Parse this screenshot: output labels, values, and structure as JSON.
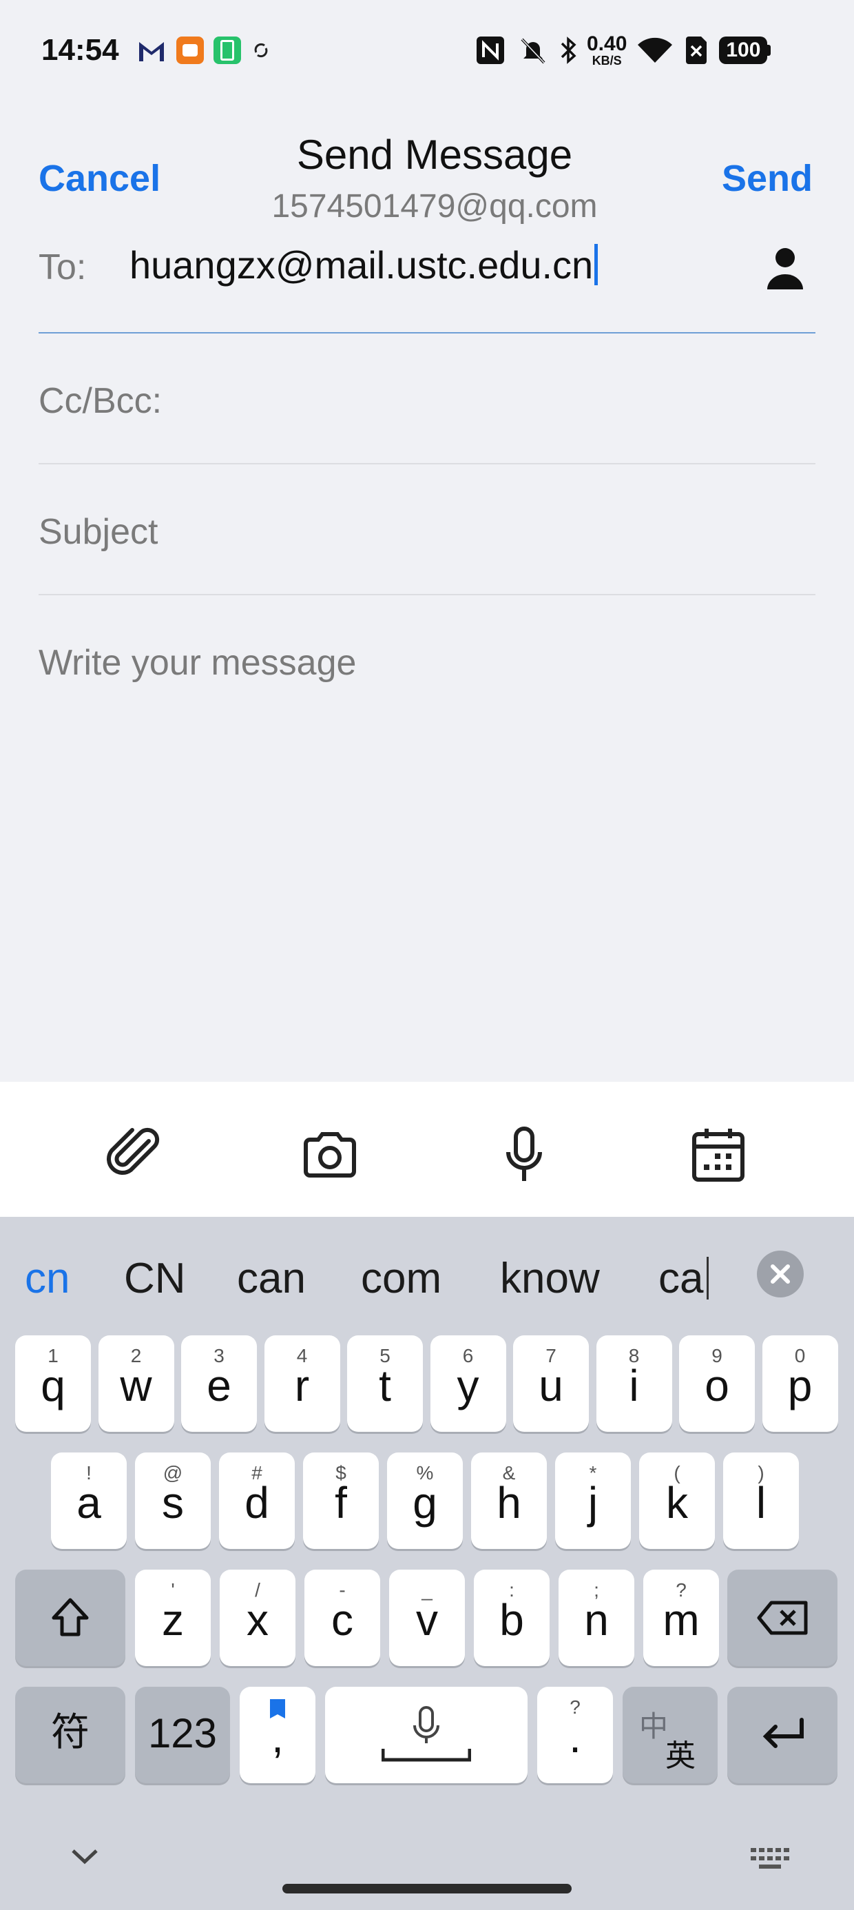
{
  "status": {
    "time": "14:54",
    "net_speed": "0.40",
    "net_unit": "KB/S",
    "battery": "100",
    "icons": [
      "gmail-icon",
      "app-icon",
      "battery-saver-icon",
      "sync-icon",
      "nfc-icon",
      "mute-icon",
      "bluetooth-icon",
      "wifi-icon",
      "sim-off-icon",
      "battery-icon"
    ]
  },
  "header": {
    "cancel": "Cancel",
    "title": "Send Message",
    "from": "1574501479@qq.com",
    "send": "Send"
  },
  "fields": {
    "to_label": "To:",
    "to_value": "huangzx@mail.ustc.edu.cn",
    "cc_label": "Cc/Bcc:",
    "subject_placeholder": "Subject",
    "message_placeholder": "Write your message"
  },
  "toolbar": [
    "attach-icon",
    "camera-icon",
    "microphone-icon",
    "calendar-icon"
  ],
  "suggestions": [
    "cn",
    "CN",
    "can",
    "com",
    "know",
    "ca"
  ],
  "keyboard": {
    "row1": [
      {
        "k": "q",
        "h": "1"
      },
      {
        "k": "w",
        "h": "2"
      },
      {
        "k": "e",
        "h": "3"
      },
      {
        "k": "r",
        "h": "4"
      },
      {
        "k": "t",
        "h": "5"
      },
      {
        "k": "y",
        "h": "6"
      },
      {
        "k": "u",
        "h": "7"
      },
      {
        "k": "i",
        "h": "8"
      },
      {
        "k": "o",
        "h": "9"
      },
      {
        "k": "p",
        "h": "0"
      }
    ],
    "row2": [
      {
        "k": "a",
        "h": "!"
      },
      {
        "k": "s",
        "h": "@"
      },
      {
        "k": "d",
        "h": "#"
      },
      {
        "k": "f",
        "h": "$"
      },
      {
        "k": "g",
        "h": "%"
      },
      {
        "k": "h",
        "h": "&"
      },
      {
        "k": "j",
        "h": "*"
      },
      {
        "k": "k",
        "h": "("
      },
      {
        "k": "l",
        "h": ")"
      }
    ],
    "row3": [
      {
        "k": "z",
        "h": "'"
      },
      {
        "k": "x",
        "h": "/"
      },
      {
        "k": "c",
        "h": "-"
      },
      {
        "k": "v",
        "h": "_"
      },
      {
        "k": "b",
        "h": ":"
      },
      {
        "k": "n",
        "h": ";"
      },
      {
        "k": "m",
        "h": "?"
      }
    ],
    "symbols_key": "符",
    "num_key": "123",
    "comma": ",",
    "period": ".",
    "period_hint": "?",
    "lang_zh": "中",
    "lang_en": "英"
  },
  "colors": {
    "accent": "#1a73e8",
    "background": "#f0f1f5",
    "keyboard": "#d1d4dc"
  }
}
